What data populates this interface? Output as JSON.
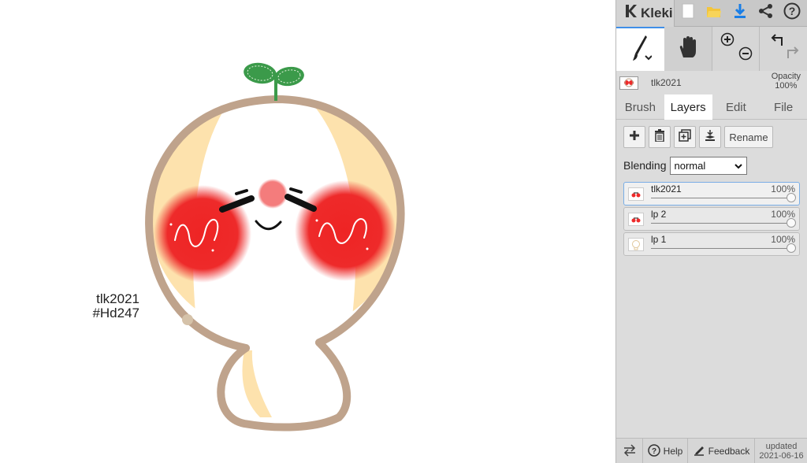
{
  "canvas": {
    "caption_line1": "tlk2021",
    "caption_line2": "#Hd247"
  },
  "topbar": {
    "app_name": "Kleki",
    "icons": [
      "kleki-logo-icon",
      "new-image-icon",
      "open-folder-icon",
      "download-icon",
      "share-icon",
      "help-icon"
    ]
  },
  "tools": {
    "icons": [
      "brush-tool-icon",
      "hand-tool-icon",
      "zoom-in-icon",
      "zoom-out-icon",
      "undo-icon",
      "redo-icon"
    ]
  },
  "current_layer": {
    "name": "tlk2021",
    "opacity_label": "Opacity",
    "opacity_value": "100%"
  },
  "tabs": {
    "brush": "Brush",
    "layers": "Layers",
    "edit": "Edit",
    "file": "File",
    "active": "Layers"
  },
  "layers_panel": {
    "rename_label": "Rename",
    "blending_label": "Blending",
    "blending_value": "normal",
    "layers": [
      {
        "name": "tlk2021",
        "opacity": "100%",
        "opacity_fraction": 1.0
      },
      {
        "name": "lp 2",
        "opacity": "100%",
        "opacity_fraction": 1.0
      },
      {
        "name": "lp 1",
        "opacity": "100%",
        "opacity_fraction": 1.0
      }
    ]
  },
  "bottombar": {
    "help_label": "Help",
    "feedback_label": "Feedback",
    "updated_label": "updated",
    "updated_date": "2021-06-16"
  },
  "colors": {
    "accent": "#3f8fe8",
    "outline": "#bfa38c",
    "blush": "#ee2a2a",
    "cream": "#fde2ad",
    "sprout": "#3b9a4a"
  }
}
